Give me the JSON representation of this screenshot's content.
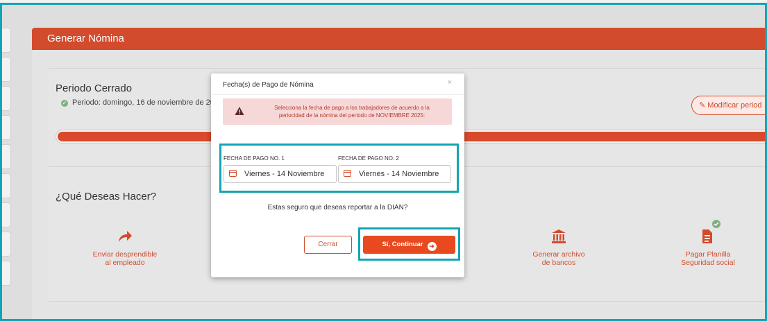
{
  "card": {
    "title": "Generar Nómina"
  },
  "status": {
    "title": "Periodo Cerrado",
    "period_text": "Periodo: domingo, 16 de noviembre de 20",
    "modify_label": "Modificar period",
    "progress_percent": 100
  },
  "actions": {
    "title": "¿Qué Deseas Hacer?",
    "items": [
      {
        "label_line1": "Enviar desprendible",
        "label_line2": "al empleado"
      },
      {
        "label_line1": "Generar archivo",
        "label_line2": "de bancos"
      },
      {
        "label_line1": "Pagar Planilla",
        "label_line2": "Seguridad social"
      }
    ]
  },
  "modal": {
    "title": "Fecha(s) de Pago de Nómina",
    "close_glyph": "×",
    "alert_text": "Selecciona la fecha de pago a los trabajadores de acuerdo a la periocidad de la nómina del periodo de NOVIEMBRE 2025:",
    "dates": [
      {
        "label": "FECHA DE PAGO NO. 1",
        "value": "Viernes - 14 Noviembre"
      },
      {
        "label": "FECHA DE PAGO NO. 2",
        "value": "Viernes - 14 Noviembre"
      }
    ],
    "question": "Estas seguro que deseas reportar a la DIAN?",
    "close_button": "Cerrar",
    "confirm_button": "Sí, Continuar"
  },
  "colors": {
    "brand": "#d24b2c",
    "highlight": "#11a5b5",
    "alert_bg": "#f6d8d8"
  },
  "icons": [
    "calendar-icon",
    "warning-icon",
    "share-arrow-icon",
    "bank-icon",
    "document-icon",
    "check-circle-icon",
    "pencil-icon",
    "arrow-right-icon",
    "close-icon"
  ]
}
